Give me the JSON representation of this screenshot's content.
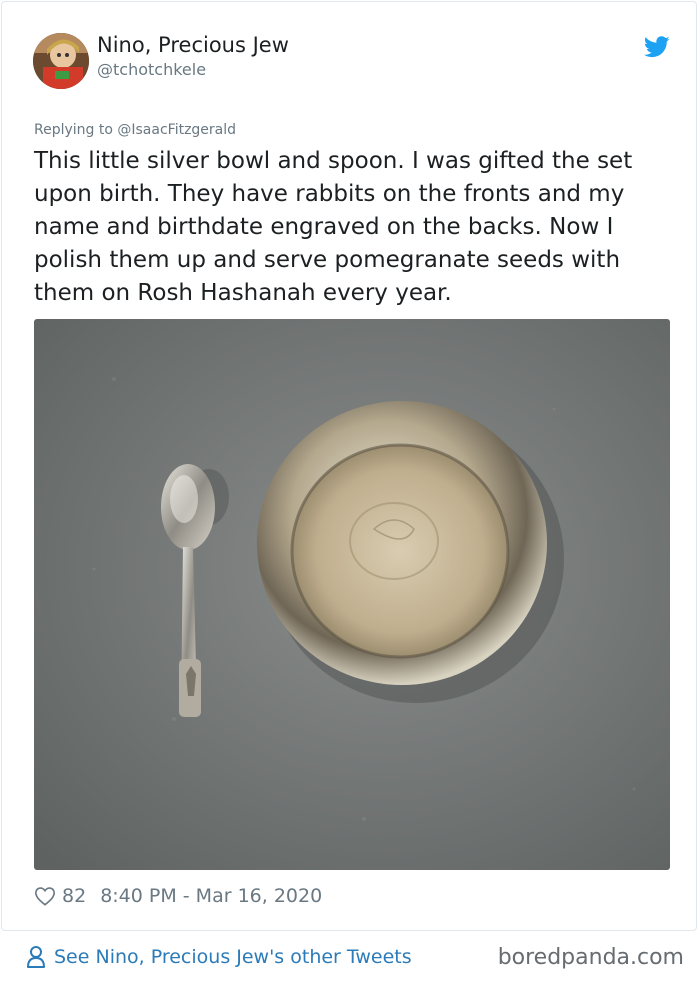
{
  "tweet": {
    "display_name": "Nino, Precious Jew",
    "handle": "@tchotchkele",
    "replying_to": "Replying to @IsaacFitzgerald",
    "text": "This little silver bowl and spoon. I was gifted the set upon birth. They have rabbits on the fronts and my name and birthdate engraved on the backs. Now I polish them up and serve pomegranate seeds with them on Rosh Hashanah every year.",
    "like_count": "82",
    "timestamp": "8:40 PM - Mar 16, 2020",
    "photo_icon": "silver-bowl-and-spoon-photo"
  },
  "footer": {
    "other_tweets_link": "See Nino, Precious Jew's other Tweets",
    "watermark": "boredpanda.com"
  },
  "icons": {
    "brand": "twitter-bird-icon",
    "like": "heart-icon",
    "profile": "user-icon"
  },
  "colors": {
    "twitter_blue": "#1da1f2",
    "link": "#2b7bb9",
    "secondary_text": "#697882",
    "primary_text": "#1c2022"
  }
}
